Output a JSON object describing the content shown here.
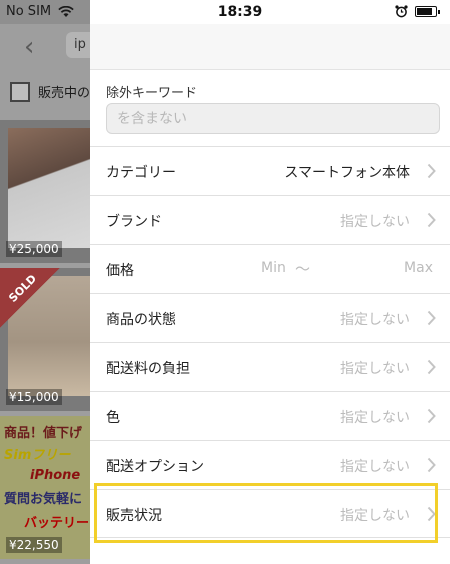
{
  "status_bar": {
    "carrier": "No SIM",
    "time": "18:39",
    "icons": [
      "wifi-icon",
      "alarm-icon",
      "battery-icon"
    ]
  },
  "background_list": {
    "search_text": "ip",
    "filter_checkbox_label": "販売中の",
    "items": [
      {
        "price": "¥25,000",
        "sold": false
      },
      {
        "price": "¥15,000",
        "sold": true,
        "sold_label": "SOLD"
      },
      {
        "price": "¥22,550",
        "sold": false,
        "promo_lines": [
          "商品！値下げ",
          "Simフリー",
          "iPhone",
          "質問お気軽に",
          "バッテリー"
        ]
      }
    ]
  },
  "filter_panel": {
    "exclude_keyword": {
      "title": "除外キーワード",
      "placeholder": "を含まない",
      "value": ""
    },
    "rows": {
      "category": {
        "label": "カテゴリー",
        "value": "スマートフォン本体"
      },
      "brand": {
        "label": "ブランド",
        "value": "指定しない"
      },
      "price": {
        "label": "価格",
        "min_placeholder": "Min",
        "separator": "〜",
        "max_placeholder": "Max"
      },
      "condition": {
        "label": "商品の状態",
        "value": "指定しない"
      },
      "shipping_fee": {
        "label": "配送料の負担",
        "value": "指定しない"
      },
      "color": {
        "label": "色",
        "value": "指定しない"
      },
      "shipping_option": {
        "label": "配送オプション",
        "value": "指定しない"
      },
      "sales_status": {
        "label": "販売状況",
        "value": "指定しない"
      }
    }
  },
  "colors": {
    "highlight": "#f2cf2a",
    "placeholder": "#bcbcbc",
    "overlay": "#9e9e9e"
  }
}
